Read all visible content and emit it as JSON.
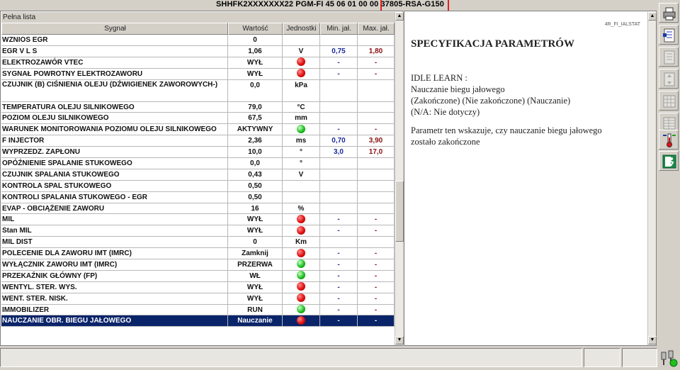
{
  "title_bar": {
    "text": "SHHFK2XXXXXXX22  PGM-FI  45 06 01 00 00  37805-RSA-G150"
  },
  "table": {
    "list_title": "Pełna lista",
    "headers": [
      "Sygnał",
      "Wartość",
      "Jednostki",
      "Min. jał.",
      "Max. jał."
    ],
    "rows": [
      {
        "signal": "WZNIOS EGR",
        "value": "0",
        "unit": "",
        "min": "",
        "max": ""
      },
      {
        "signal": "EGR V L S",
        "value": "1,06",
        "unit": "V",
        "min": "0,75",
        "max": "1,80"
      },
      {
        "signal": "ELEKTROZAWÓR VTEC",
        "value": "WYŁ",
        "unit": "red-dot-icon",
        "min": "-",
        "max": "-"
      },
      {
        "signal": "SYGNAŁ POWROTNY ELEKTROZAWORU",
        "value": "WYŁ",
        "unit": "red-dot-icon",
        "min": "-",
        "max": "-"
      },
      {
        "signal": "CZUJNIK (B) CIŚNIENIA OLEJU (DŹWIGIENEK ZAWOROWYCH-)",
        "value": "0,0",
        "unit": "kPa",
        "min": "",
        "max": "",
        "tall": true
      },
      {
        "signal": "TEMPERATURA OLEJU SILNIKOWEGO",
        "value": "79,0",
        "unit": "°C",
        "min": "",
        "max": ""
      },
      {
        "signal": "POZIOM OLEJU SILNIKOWEGO",
        "value": "67,5",
        "unit": "mm",
        "min": "",
        "max": ""
      },
      {
        "signal": "WARUNEK MONITOROWANIA POZIOMU OLEJU SILNIKOWEGO",
        "value": "AKTYWNY",
        "unit": "green-dot-icon",
        "min": "-",
        "max": "-"
      },
      {
        "signal": "F INJECTOR",
        "value": "2,36",
        "unit": "ms",
        "min": "0,70",
        "max": "3,90"
      },
      {
        "signal": "WYPRZEDZ. ZAPŁONU",
        "value": "10,0",
        "unit": "°",
        "min": "3,0",
        "max": "17,0"
      },
      {
        "signal": "OPÓŹNIENIE SPALANIE STUKOWEGO",
        "value": "0,0",
        "unit": "°",
        "min": "",
        "max": ""
      },
      {
        "signal": "CZUJNIK SPALANIA STUKOWEGO",
        "value": "0,43",
        "unit": "V",
        "min": "",
        "max": ""
      },
      {
        "signal": "KONTROLA SPAL STUKOWEGO",
        "value": "0,50",
        "unit": "",
        "min": "",
        "max": ""
      },
      {
        "signal": "KONTROLI SPALANIA STUKOWEGO - EGR",
        "value": "0,50",
        "unit": "",
        "min": "",
        "max": ""
      },
      {
        "signal": "EVAP - OBCIĄŻENIE ZAWORU",
        "value": "16",
        "unit": "%",
        "min": "",
        "max": ""
      },
      {
        "signal": "MIL",
        "value": "WYŁ",
        "unit": "red-dot-icon",
        "min": "-",
        "max": "-"
      },
      {
        "signal": "Stan MIL",
        "value": "WYŁ",
        "unit": "red-dot-icon",
        "min": "-",
        "max": "-"
      },
      {
        "signal": "MIL DIST",
        "value": "0",
        "unit": "Km",
        "min": "",
        "max": ""
      },
      {
        "signal": "POLECENIE DLA ZAWORU IMT (IMRC)",
        "value": "Zamknij",
        "unit": "red-dot-icon",
        "min": "-",
        "max": "-"
      },
      {
        "signal": "WYŁĄCZNIK ZAWORU IMT (IMRC)",
        "value": "PRZERWA",
        "unit": "green-dot-icon",
        "min": "-",
        "max": "-"
      },
      {
        "signal": "PRZEKAŹNIK GŁÓWNY (FP)",
        "value": "WŁ",
        "unit": "green-dot-icon",
        "min": "-",
        "max": "-"
      },
      {
        "signal": "WENTYL. STER. WYS.",
        "value": "WYŁ",
        "unit": "red-dot-icon",
        "min": "-",
        "max": "-"
      },
      {
        "signal": "WENT. STER. NISK.",
        "value": "WYŁ",
        "unit": "red-dot-icon",
        "min": "-",
        "max": "-"
      },
      {
        "signal": "IMMOBILIZER",
        "value": "RUN",
        "unit": "green-dot-icon",
        "min": "-",
        "max": "-"
      },
      {
        "signal": "NAUCZANIE OBR. BIEGU JAŁOWEGO",
        "value": "Nauczanie",
        "unit": "red-dot-icon",
        "min": "-",
        "max": "-",
        "selected": true
      }
    ]
  },
  "spec": {
    "ref": "4R_FI_IALSTAT",
    "title": "SPECYFIKACJA PARAMETRÓW",
    "paragraphs": [
      [
        "IDLE LEARN :",
        "Nauczanie biegu jałowego",
        "(Zakończone) (Nie zakończone) (Nauczanie)",
        "(N/A: Nie dotyczy)"
      ],
      [
        "Parametr ten wskazuje, czy nauczanie biegu jałowego",
        "zostało zakończone"
      ]
    ]
  },
  "toolbar": {
    "icons": [
      "printer-icon",
      "settings-list-icon",
      "list-icon",
      "list-arrows-icon",
      "grid-icon",
      "table-icon",
      "thermometer-icon",
      "exit-icon"
    ]
  },
  "status_bar": {
    "icon": "connection-status-icon"
  },
  "colors": {
    "selection": "#0a246a",
    "min_text": "#1a2a9a",
    "max_text": "#8a1010",
    "highlight_box": "#e02020",
    "status_red": "#e01010",
    "status_green": "#20c020"
  }
}
